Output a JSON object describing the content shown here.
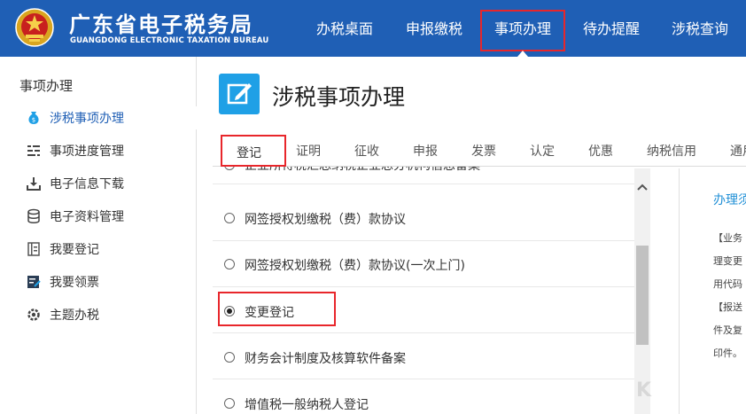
{
  "header": {
    "title": "广东省电子税务局",
    "subtitle": "GUANGDONG ELECTRONIC TAXATION BUREAU",
    "nav": [
      {
        "label": "办税桌面"
      },
      {
        "label": "申报缴税"
      },
      {
        "label": "事项办理",
        "active": true
      },
      {
        "label": "待办提醒"
      },
      {
        "label": "涉税查询"
      }
    ],
    "brand_color": "#1f5fb5",
    "highlight_color": "#e8262b"
  },
  "sidebar": {
    "title": "事项办理",
    "items": [
      {
        "label": "涉税事项办理",
        "icon": "money-bag-icon",
        "active": true
      },
      {
        "label": "事项进度管理",
        "icon": "progress-list-icon"
      },
      {
        "label": "电子信息下载",
        "icon": "download-icon"
      },
      {
        "label": "电子资料管理",
        "icon": "database-icon"
      },
      {
        "label": "我要登记",
        "icon": "register-book-icon"
      },
      {
        "label": "我要领票",
        "icon": "invoice-icon"
      },
      {
        "label": "主题办税",
        "icon": "gear-icon"
      }
    ]
  },
  "main": {
    "title": "涉税事项办理",
    "title_icon": "edit-icon",
    "tabs": [
      {
        "label": "登记",
        "active": true
      },
      {
        "label": "证明"
      },
      {
        "label": "征收"
      },
      {
        "label": "申报"
      },
      {
        "label": "发票"
      },
      {
        "label": "认定"
      },
      {
        "label": "优惠"
      },
      {
        "label": "纳税信用"
      },
      {
        "label": "通用"
      }
    ],
    "items": [
      {
        "label": "企业所得税汇总纳税企业总分机构信息备案",
        "checked": false
      },
      {
        "label": "网签授权划缴税（费）款协议",
        "checked": false
      },
      {
        "label": "网签授权划缴税（费）款协议(一次上门)",
        "checked": false
      },
      {
        "label": "变更登记",
        "checked": true
      },
      {
        "label": "财务会计制度及核算软件备案",
        "checked": false
      },
      {
        "label": "增值税一般纳税人登记",
        "checked": false
      }
    ]
  },
  "right_panel": {
    "title": "办理须",
    "lines": [
      "【业务",
      "理变更",
      "用代码",
      "【报送",
      "件及复",
      "印件。"
    ]
  },
  "watermark": "K"
}
